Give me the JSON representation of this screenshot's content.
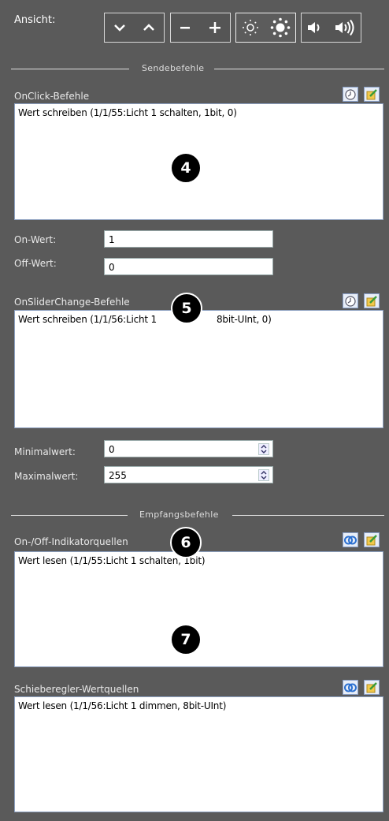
{
  "ansicht": {
    "label": "Ansicht:"
  },
  "dividers": {
    "send": "Sendebefehle",
    "receive": "Empfangsbefehle"
  },
  "onclick": {
    "label": "OnClick-Befehle",
    "items": [
      "Wert schreiben (1/1/55:Licht 1 schalten, 1bit, 0)"
    ],
    "on_label": "On-Wert:",
    "on_value": "1",
    "off_label": "Off-Wert:",
    "off_value": "0"
  },
  "onslider": {
    "label": "OnSliderChange-Befehle",
    "items": [
      "Wert schreiben (1/1/56:Licht 1 ",
      "8bit-UInt, 0)"
    ],
    "min_label": "Minimalwert:",
    "min_value": "0",
    "max_label": "Maximalwert:",
    "max_value": "255"
  },
  "onoff_sources": {
    "label": "On-/Off-Indikatorquellen",
    "items": [
      "Wert lesen (1/1/55:Licht 1 schalten, 1bit)"
    ]
  },
  "slider_sources": {
    "label": "Schieberegler-Wertquellen",
    "items": [
      "Wert lesen (1/1/56:Licht 1 dimmen, 8bit-UInt)"
    ]
  },
  "callouts": {
    "c4": "4",
    "c5": "5",
    "c6": "6",
    "c7": "7"
  },
  "icons": [
    "chevron-down-icon",
    "chevron-up-icon",
    "minus-icon",
    "plus-icon",
    "brightness-low-icon",
    "brightness-high-icon",
    "volume-low-icon",
    "volume-high-icon",
    "clock-icon",
    "add-edit-icon",
    "link-icon"
  ]
}
